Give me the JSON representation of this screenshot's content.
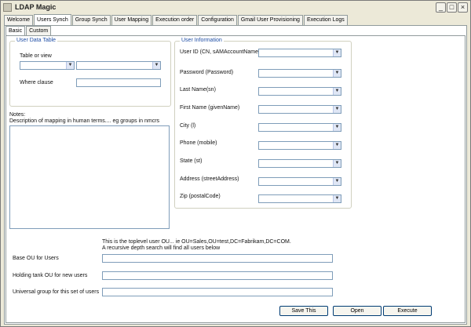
{
  "window": {
    "title": "LDAP Magic",
    "minimize": "_",
    "maximize": "□",
    "close": "×"
  },
  "tabs": [
    {
      "label": "Welcome"
    },
    {
      "label": "Users Synch"
    },
    {
      "label": "Group Synch"
    },
    {
      "label": "User Mapping"
    },
    {
      "label": "Execution order"
    },
    {
      "label": "Configuration"
    },
    {
      "label": "Gmail User Provisioning"
    },
    {
      "label": "Execution Logs"
    }
  ],
  "active_tab": "Users Synch",
  "subtabs": [
    {
      "label": "Basic"
    },
    {
      "label": "Custom"
    }
  ],
  "user_data_table": {
    "title": "User Data Table",
    "table_label": "Table or view",
    "where_label": "Where clause",
    "table_value": "",
    "view_value": "",
    "where_value": ""
  },
  "notes": {
    "label": "Notes:",
    "text": "Description of mapping in human terms.... eg groups in nmcrs"
  },
  "user_information": {
    "title": "User Information",
    "fields": [
      {
        "label": "User ID (CN, sAMAccountName)",
        "value": ""
      },
      {
        "label": "Password (Password)",
        "value": ""
      },
      {
        "label": "Last Name(sn)",
        "value": ""
      },
      {
        "label": "First Name (givenName)",
        "value": ""
      },
      {
        "label": "City (l)",
        "value": ""
      },
      {
        "label": "Phone (mobile)",
        "value": ""
      },
      {
        "label": "State (st)",
        "value": ""
      },
      {
        "label": "Address (streetAddress)",
        "value": ""
      },
      {
        "label": "Zip (postalCode)",
        "value": ""
      }
    ]
  },
  "ou_section": {
    "hint_line1": "This is the toplevel user OU... ie OU=Sales,OU=test,DC=Fabrikam,DC=COM.",
    "hint_line2": "A recursive depth search will find all users below",
    "base_ou_label": "Base OU for Users",
    "holding_label": "Holding tank OU for new users",
    "universal_label": "Universal group for this set of users",
    "base_ou_value": "",
    "holding_value": "",
    "universal_value": ""
  },
  "actions": {
    "save": "Save This",
    "open": "Open",
    "execute": "Execute"
  },
  "icons": {
    "dropdown": "chevron-down-icon",
    "app": "app-icon"
  }
}
